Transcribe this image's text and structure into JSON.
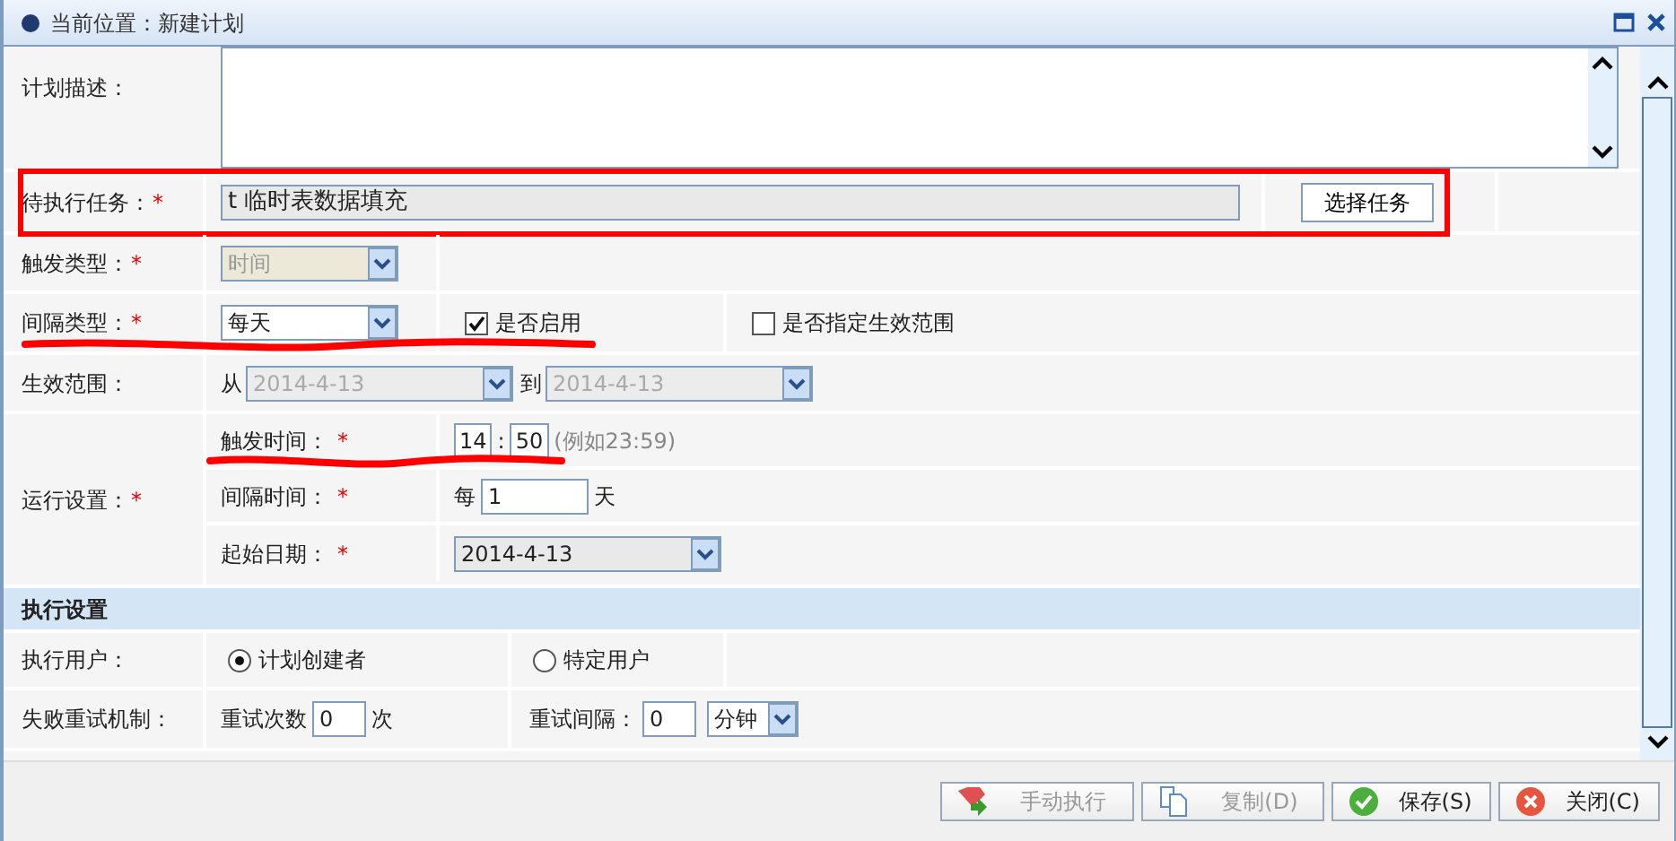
{
  "window": {
    "title": "当前位置：新建计划"
  },
  "form": {
    "description": {
      "label": "计划描述："
    },
    "task": {
      "label": "待执行任务：",
      "required": "*",
      "value": "t 临时表数据填充",
      "button": "选择任务",
      "highlighted": true
    },
    "trigger_type": {
      "label": "触发类型：",
      "required": "*",
      "value": "时间",
      "disabled": true
    },
    "interval_type": {
      "label": "间隔类型：",
      "required": "*",
      "value": "每天",
      "underlined": true,
      "checkboxes": [
        {
          "label": "是否启用",
          "checked": true
        },
        {
          "label": "是否指定生效范围",
          "checked": false
        }
      ]
    },
    "effective_range": {
      "label": "生效范围：",
      "from_label": "从",
      "from": "2014-4-13",
      "to_label": "到",
      "to": "2014-4-13",
      "disabled": true
    },
    "run_settings": {
      "label": "运行设置：",
      "required": "*",
      "trigger_time": {
        "label": "触发时间：",
        "required": "*",
        "hour": "14",
        "separator": ":",
        "minute": "50",
        "hint": "(例如23:59)",
        "underlined": true
      },
      "interval": {
        "label": "间隔时间：",
        "required": "*",
        "prefix": "每",
        "value": "1",
        "suffix": "天"
      },
      "start_date": {
        "label": "起始日期：",
        "required": "*",
        "value": "2014-4-13"
      }
    }
  },
  "section": {
    "title": "执行设置"
  },
  "exec_user": {
    "label": "执行用户：",
    "options": [
      {
        "label": "计划创建者",
        "selected": true
      },
      {
        "label": "特定用户",
        "selected": false
      }
    ]
  },
  "retry": {
    "label": "失败重试机制：",
    "count_label": "重试次数",
    "count": "0",
    "count_unit": "次",
    "interval_label": "重试间隔：",
    "interval": "0",
    "unit": "分钟"
  },
  "buttons": [
    {
      "label": "手动执行",
      "kind": "run",
      "disabled": true
    },
    {
      "label": "复制(D)",
      "kind": "copy",
      "disabled": true
    },
    {
      "label": "保存(S)",
      "kind": "save",
      "disabled": false
    },
    {
      "label": "关闭(C)",
      "kind": "close",
      "disabled": false
    }
  ]
}
